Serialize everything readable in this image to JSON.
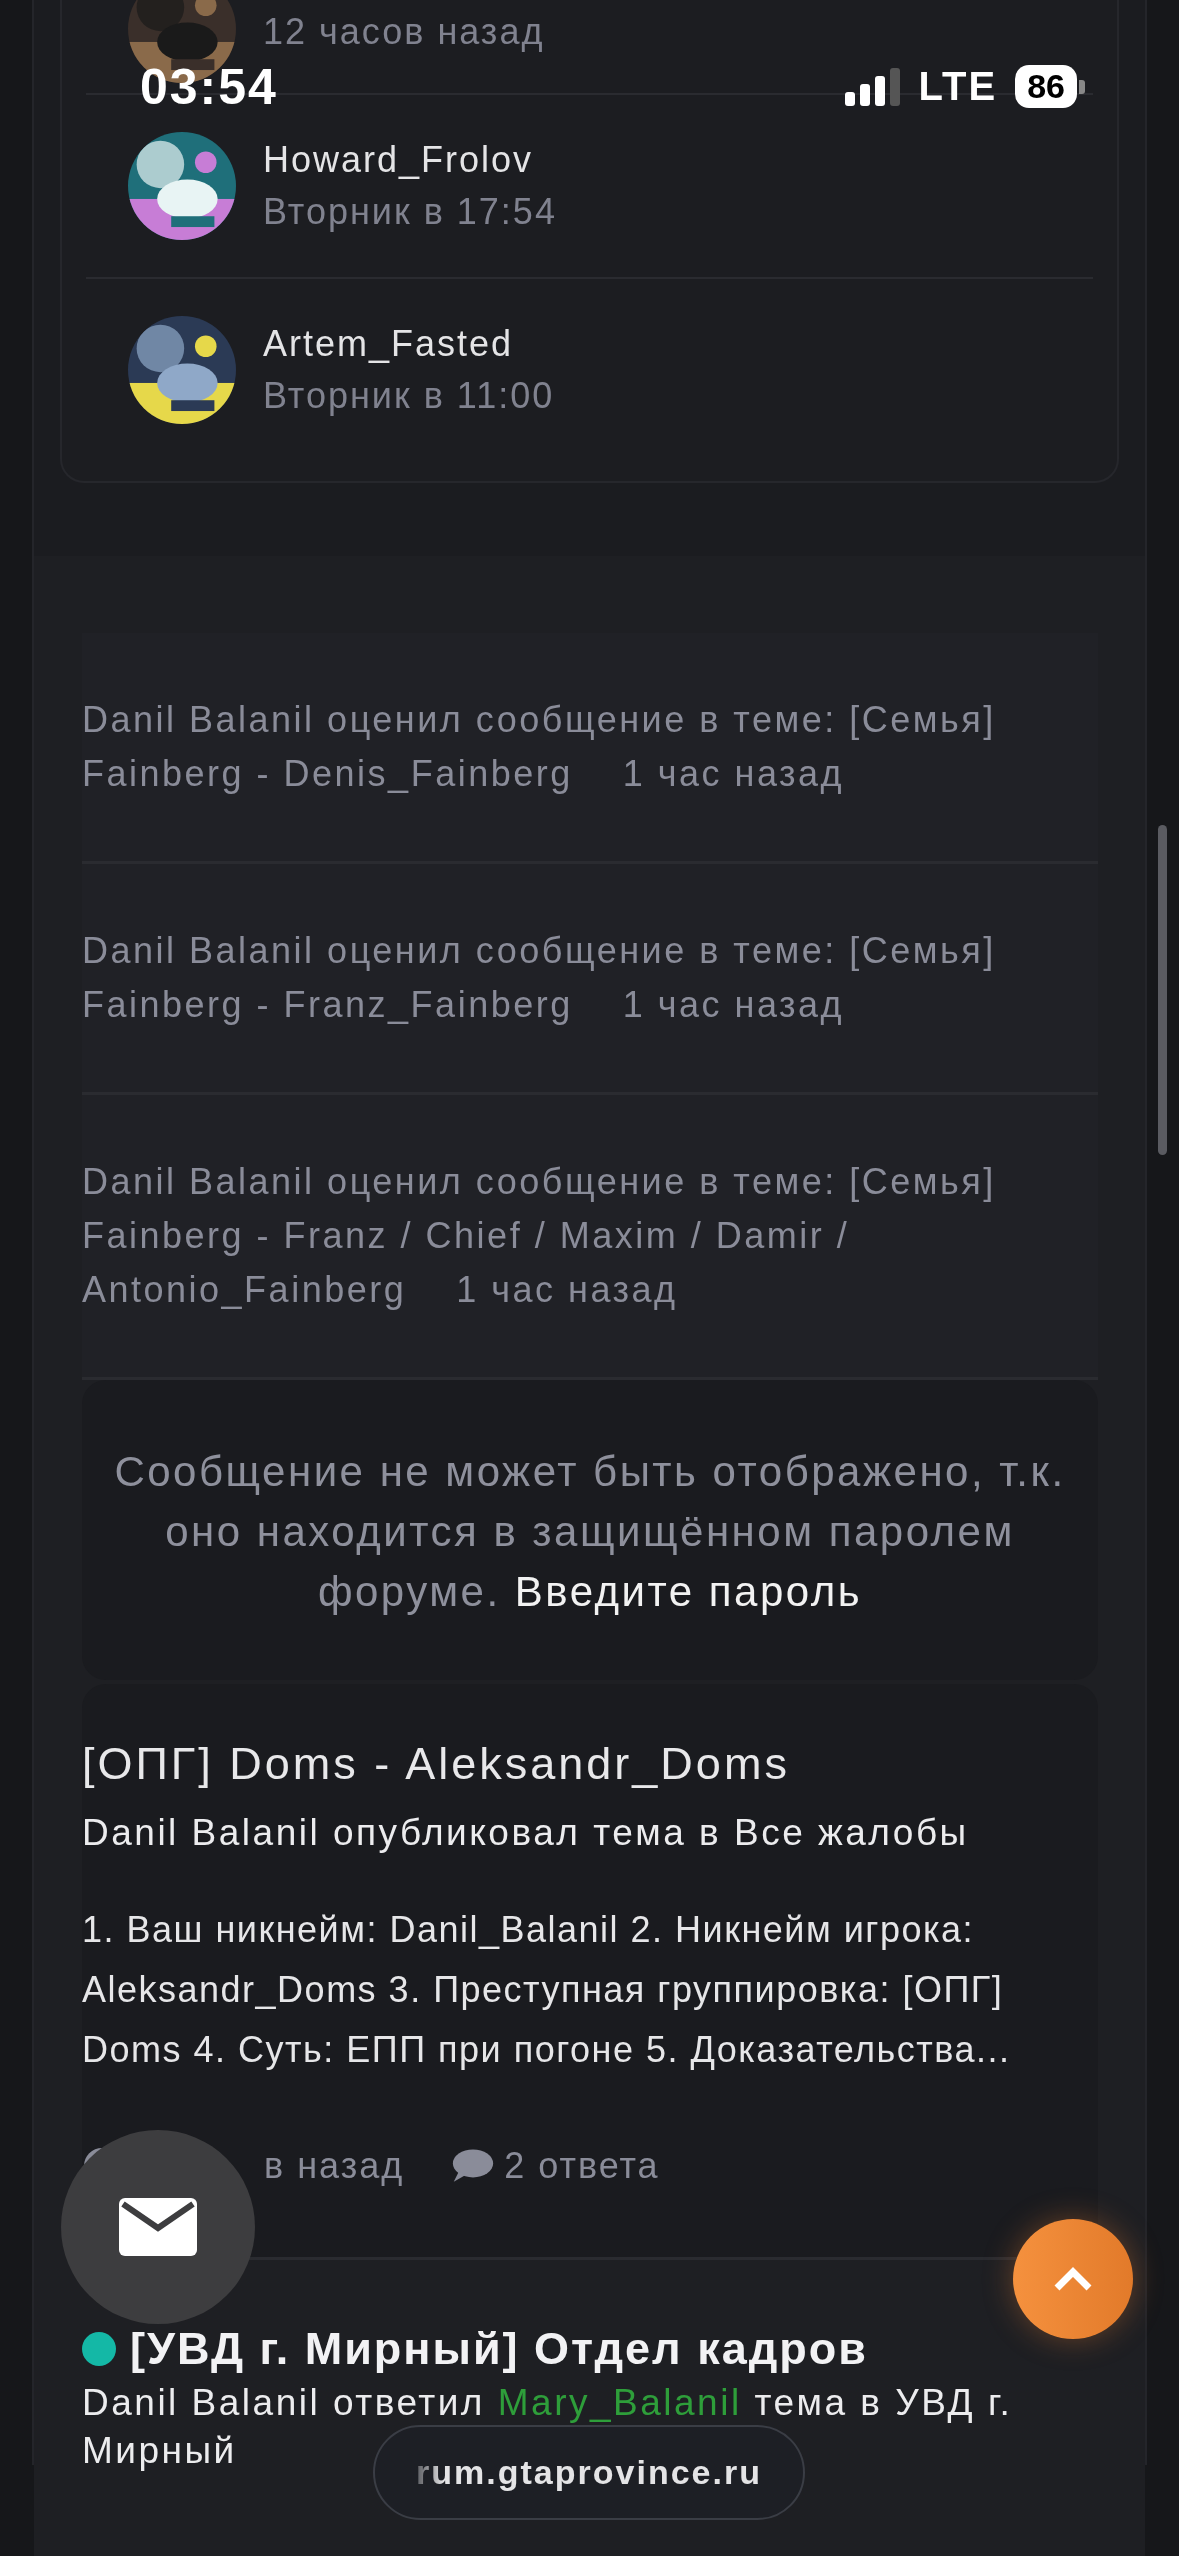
{
  "status_bar": {
    "time": "03:54",
    "network": "LTE",
    "battery": "86"
  },
  "recent_visitors": [
    {
      "kind": "partial",
      "time": "12 часов назад"
    },
    {
      "kind": "full",
      "name": "Howard_Frolov",
      "time": "Вторник в 17:54"
    },
    {
      "kind": "full",
      "name": "Artem_Fasted",
      "time": "Вторник в 11:00"
    }
  ],
  "activity": [
    {
      "text": "Danil Balanil оценил сообщение в теме: [Семья] Fainberg - Denis_Fainberg",
      "time": "1 час назад"
    },
    {
      "text": "Danil Balanil оценил сообщение в теме: [Семья] Fainberg - Franz_Fainberg",
      "time": "1 час назад"
    },
    {
      "text": "Danil Balanil оценил сообщение в теме: [Семья] Fainberg - Franz / Chief / Maxim / Damir / Antonio_Fainberg",
      "time": "1 час назад"
    }
  ],
  "protected_notice": {
    "text": "Сообщение не может быть отображено, т.к. оно находится в защищённом паролем форуме.",
    "link": "Введите пароль"
  },
  "topic": {
    "title": "[ОПГ] Doms - Aleksandr_Doms",
    "byline": "Danil Balanil опубликовал тема в Все жалобы",
    "snippet": "1. Ваш никнейм: Danil_Balanil 2. Никнейм игрока: Aleksandr_Doms 3. Преступная группировка: [ОПГ] Doms 4. Суть: ЕПП при погоне 5. Доказательства...",
    "time": "в назад",
    "replies": "2 ответа"
  },
  "next_topic": {
    "unread": true,
    "title": "[УВД г. Мирный] Отдел кадров",
    "byline_before": "Danil Balanil ответил",
    "byline_link": "Mary_Balanil",
    "byline_after": "тема в УВД г.",
    "byline_wrap": "Мирный"
  },
  "url_bar": "rum.gtaprovince.ru"
}
